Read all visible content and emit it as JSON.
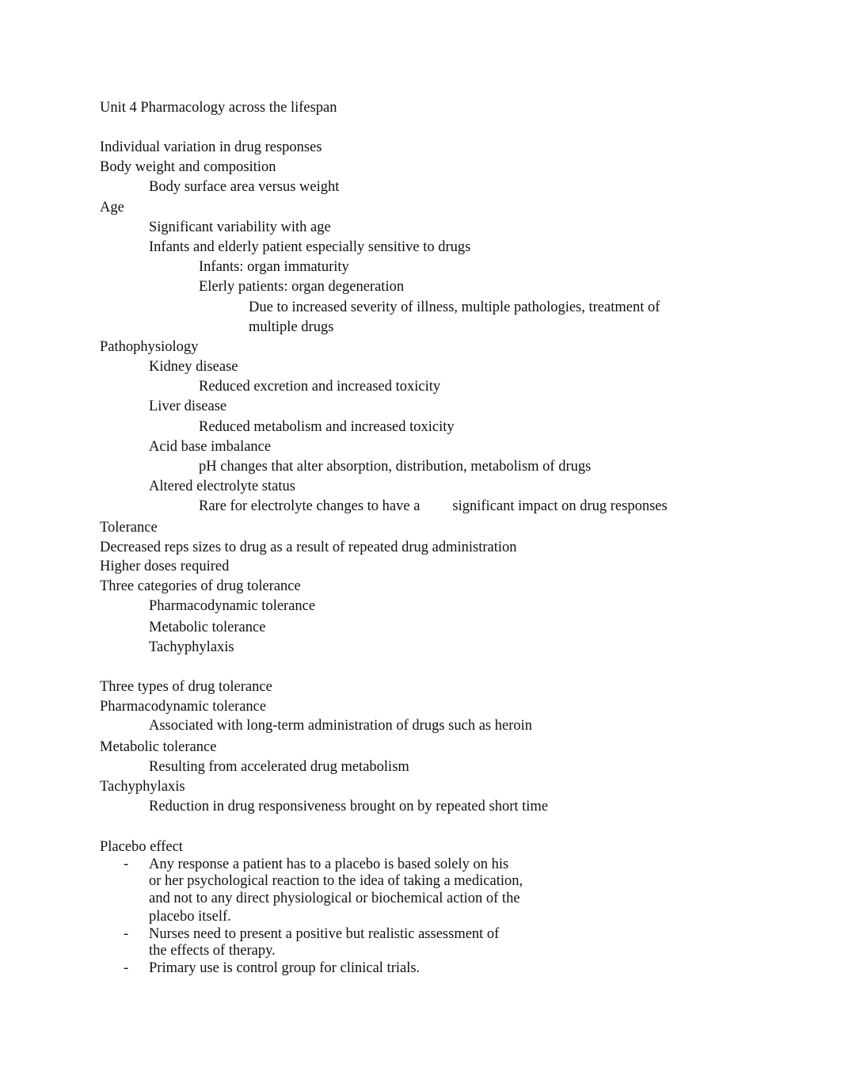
{
  "document": {
    "title": "Unit 4 Pharmacology across the lifespan",
    "sections": {
      "variation": {
        "heading": "Individual variation in drug responses",
        "body_weight": "Body weight and composition",
        "body_weight_sub": "Body surface area versus weight",
        "age": "Age",
        "age_items": [
          "Significant variability with age",
          "Infants and elderly patient especially sensitive to drugs"
        ],
        "age_subitems": [
          "Infants: organ immaturity",
          "Elerly patients: organ degeneration"
        ],
        "age_detail_line1": "Due to increased severity of illness, multiple pathologies, treatment of",
        "age_detail_line2": "multiple drugs",
        "pathophysiology": "Pathophysiology",
        "patho_items": [
          {
            "label": "Kidney disease",
            "detail": "Reduced excretion and increased toxicity"
          },
          {
            "label": "Liver disease",
            "detail": "Reduced metabolism and increased toxicity"
          },
          {
            "label": "Acid base imbalance",
            "detail": "pH changes that alter absorption, distribution, metabolism of drugs"
          },
          {
            "label": "Altered electrolyte status",
            "detail_part1": "Rare for electrolyte changes to have a",
            "detail_part2": "significant impact on drug responses"
          }
        ]
      },
      "tolerance": {
        "heading": "Tolerance",
        "lines": [
          "Decreased reps sizes to drug as a result of repeated drug administration",
          "Higher doses required",
          "Three categories of drug tolerance"
        ],
        "categories": [
          "Pharmacodynamic tolerance",
          "Metabolic tolerance",
          "Tachyphylaxis"
        ]
      },
      "types": {
        "heading": "Three types of drug tolerance",
        "items": [
          {
            "label": "Pharmacodynamic tolerance",
            "detail": "Associated with long-term administration of drugs such as heroin"
          },
          {
            "label": "Metabolic tolerance",
            "detail": "Resulting from accelerated drug metabolism"
          },
          {
            "label": "Tachyphylaxis",
            "detail": "Reduction in drug responsiveness brought on by repeated short time"
          }
        ]
      },
      "placebo": {
        "heading": "Placebo effect",
        "bullet_marker": "-",
        "bullets": [
          {
            "lines": [
              "Any response a patient has to a placebo is based solely on his",
              "or her psychological reaction to the idea of taking a medication,",
              "and not to any direct physiological or biochemical action of the",
              "placebo itself."
            ]
          },
          {
            "lines": [
              "Nurses need to present a positive but realistic assessment of",
              "the effects of therapy."
            ]
          },
          {
            "lines": [
              "Primary use is control group for clinical trials."
            ]
          }
        ]
      }
    }
  }
}
